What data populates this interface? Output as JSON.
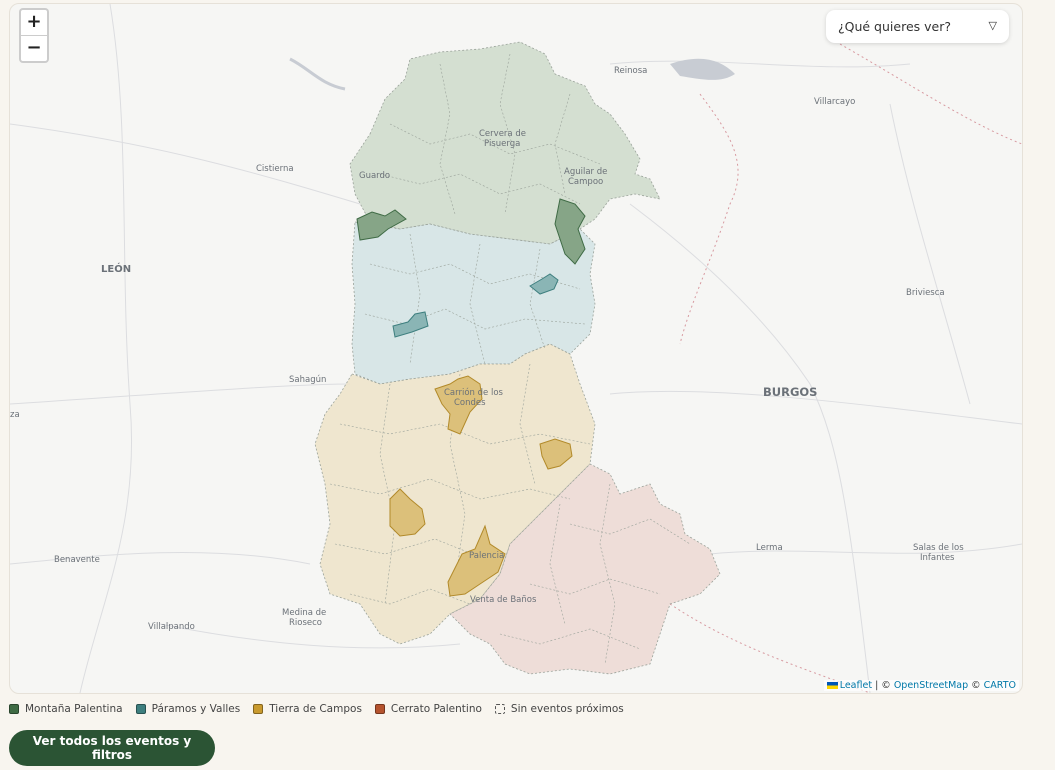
{
  "map": {
    "zoom_in": "+",
    "zoom_out": "−",
    "filter_label": "¿Qué quieres ver?",
    "filter_icon": "caret-down-icon",
    "attribution": {
      "leaflet": "Leaflet",
      "sep1": " | © ",
      "osm": "OpenStreetMap",
      "sep2": " © ",
      "carto": "CARTO"
    },
    "places": {
      "reinosa": "Reinosa",
      "villarcayo": "Villarcayo",
      "cervera1": "Cervera de",
      "cervera2": "Pisuerga",
      "aguilar1": "Aguilar de",
      "aguilar2": "Campoo",
      "guardo": "Guardo",
      "cistierna": "Cistierna",
      "leon": "LEÓN",
      "briviesca": "Briviesca",
      "sahagun": "Sahagún",
      "carrion1": "Carrión de los",
      "carrion2": "Condes",
      "burgos": "BURGOS",
      "za": "za",
      "benavente": "Benavente",
      "lerma": "Lerma",
      "salas1": "Salas de los",
      "salas2": "Infantes",
      "palencia": "Palencia",
      "medina1": "Medina de",
      "medina2": "Rioseco",
      "venta": "Venta de Baños",
      "villalpando": "Villalpando"
    }
  },
  "legend": [
    {
      "label": "Montaña Palentina",
      "color": "#3f6b45"
    },
    {
      "label": "Páramos y Valles",
      "color": "#3e7f7f"
    },
    {
      "label": "Tierra de Campos",
      "color": "#c99a2e"
    },
    {
      "label": "Cerrato Palentino",
      "color": "#b5532e"
    },
    {
      "label": "Sin eventos próximos",
      "color": ""
    }
  ],
  "cta_label": "Ver todos los eventos y filtros"
}
